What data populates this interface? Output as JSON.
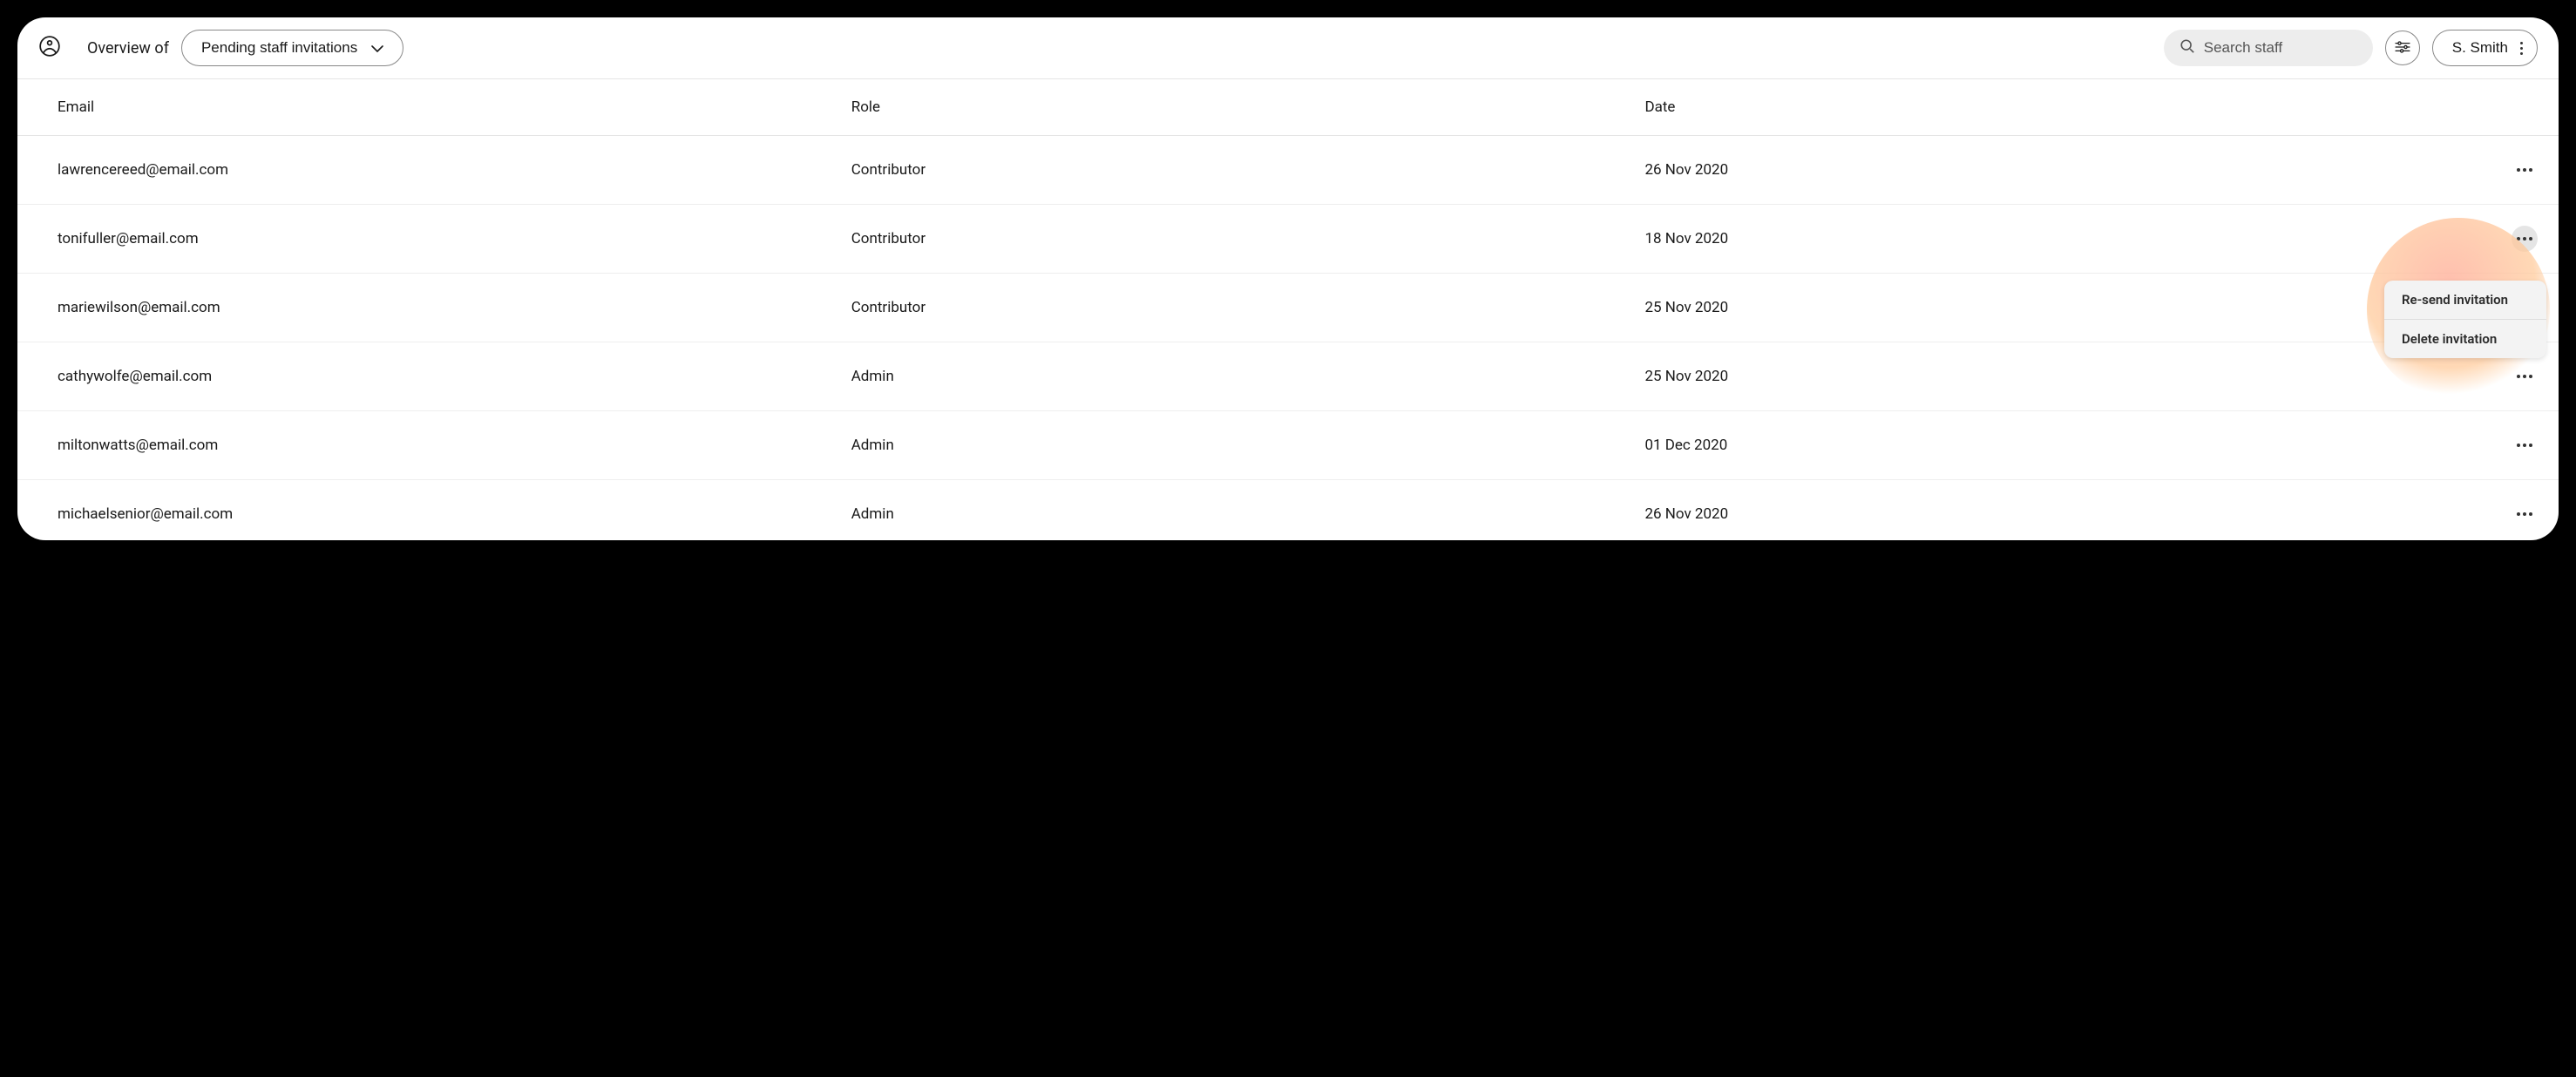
{
  "header": {
    "overview_label": "Overview of",
    "dropdown_label": "Pending staff invitations",
    "search_placeholder": "Search staff",
    "user_name": "S. Smith"
  },
  "columns": {
    "email": "Email",
    "role": "Role",
    "date": "Date"
  },
  "rows": [
    {
      "email": "lawrencereed@email.com",
      "role": "Contributor",
      "date": "26 Nov 2020"
    },
    {
      "email": "tonifuller@email.com",
      "role": "Contributor",
      "date": "18 Nov 2020"
    },
    {
      "email": "mariewilson@email.com",
      "role": "Contributor",
      "date": "25 Nov 2020"
    },
    {
      "email": "cathywolfe@email.com",
      "role": "Admin",
      "date": "25 Nov 2020"
    },
    {
      "email": "miltonwatts@email.com",
      "role": "Admin",
      "date": "01 Dec 2020"
    },
    {
      "email": "michaelsenior@email.com",
      "role": "Admin",
      "date": "26 Nov 2020"
    }
  ],
  "context_menu": {
    "resend": "Re-send invitation",
    "delete": "Delete invitation"
  },
  "active_row_index": 1
}
